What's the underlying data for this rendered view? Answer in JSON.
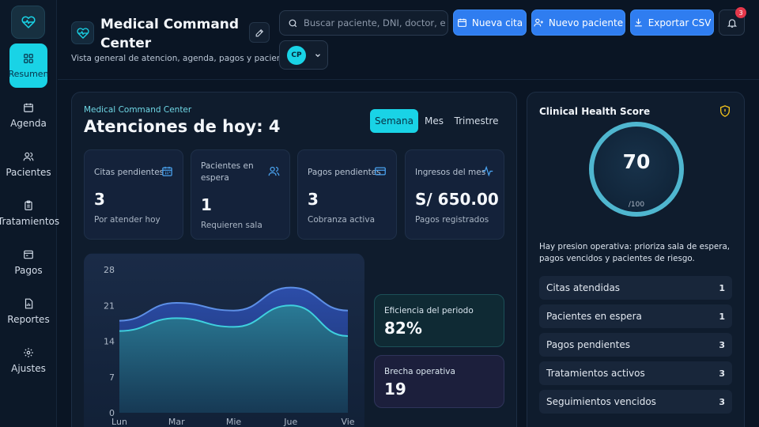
{
  "sidebar": {
    "items": [
      {
        "label": "Resumen",
        "icon": "grid-icon"
      },
      {
        "label": "Agenda",
        "icon": "calendar-icon"
      },
      {
        "label": "Pacientes",
        "icon": "users-icon"
      },
      {
        "label": "Tratamientos",
        "icon": "clipboard-icon"
      },
      {
        "label": "Pagos",
        "icon": "wallet-icon"
      },
      {
        "label": "Reportes",
        "icon": "report-icon"
      },
      {
        "label": "Ajustes",
        "icon": "gear-icon"
      }
    ]
  },
  "header": {
    "title": "Medical Command Center",
    "subtitle": "Vista general de atencion, agenda, pagos y pacientes.",
    "search_placeholder": "Buscar paciente, DNI, doctor, estado...",
    "buttons": {
      "new_appointment": "Nueva cita",
      "new_patient": "Nuevo paciente",
      "export_csv": "Exportar CSV"
    },
    "notifications_count": "3",
    "user_initials": "CP"
  },
  "overview": {
    "kicker": "Medical Command Center",
    "title": "Atenciones de hoy: 4",
    "periods": [
      "Semana",
      "Mes",
      "Trimestre"
    ],
    "active_period": "Semana",
    "stats": [
      {
        "label": "Citas pendientes",
        "value": "3",
        "note": "Por atender hoy",
        "icon": "calendar-icon"
      },
      {
        "label": "Pacientes en espera",
        "value": "1",
        "note": "Requieren sala",
        "icon": "users-icon"
      },
      {
        "label": "Pagos pendientes",
        "value": "3",
        "note": "Cobranza activa",
        "icon": "card-icon"
      },
      {
        "label": "Ingresos del mes",
        "value": "S/ 650.00",
        "note": "Pagos registrados",
        "icon": "activity-icon"
      }
    ],
    "metrics": [
      {
        "label": "Eficiencia del periodo",
        "value": "82%"
      },
      {
        "label": "Brecha operativa",
        "value": "19"
      }
    ]
  },
  "chart_data": {
    "type": "area",
    "categories": [
      "Lun",
      "Mar",
      "Mie",
      "Jue",
      "Vie"
    ],
    "yticks": [
      "28",
      "21",
      "14",
      "7",
      "0"
    ],
    "ylim": [
      0,
      28
    ],
    "series": [
      {
        "values": [
          18,
          21.5,
          20,
          24.5,
          20
        ]
      },
      {
        "values": [
          16,
          18.5,
          16.8,
          21,
          15
        ]
      }
    ],
    "colors": {
      "outer_line": "#5d8fe6",
      "inner_line": "#3fd0de"
    }
  },
  "health": {
    "title": "Clinical Health Score",
    "score": "70",
    "score_sub": "/100",
    "score_fraction": 0.7,
    "note": "Hay presion operativa: prioriza sala de espera, pagos vencidos y pacientes de riesgo.",
    "rows": [
      {
        "label": "Citas atendidas",
        "count": "1"
      },
      {
        "label": "Pacientes en espera",
        "count": "1"
      },
      {
        "label": "Pagos pendientes",
        "count": "3"
      },
      {
        "label": "Tratamientos activos",
        "count": "3"
      },
      {
        "label": "Seguimientos vencidos",
        "count": "3"
      }
    ]
  },
  "colors": {
    "accent": "#19d3e6",
    "primary": "#2f7df0",
    "background": "#0a1524",
    "badge": "#e5384b"
  }
}
